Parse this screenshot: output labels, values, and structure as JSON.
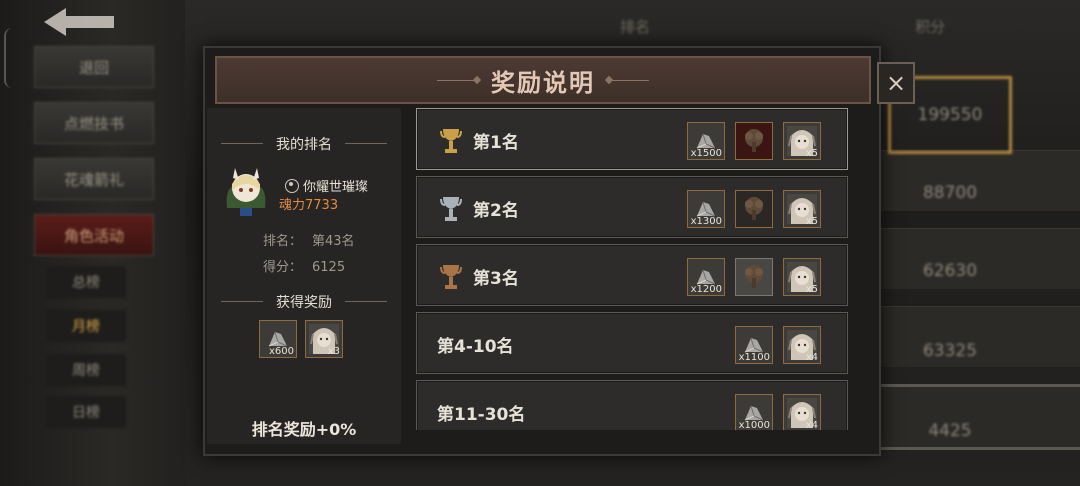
{
  "background": {
    "side_menu": [
      "退回",
      "点燃技书",
      "花魂箭礼",
      "角色活动"
    ],
    "sub_menu": [
      "总榜",
      "月榜",
      "周榜",
      "日榜"
    ],
    "header_cols": [
      "排名",
      "积分"
    ],
    "scores": [
      "199550",
      "88700",
      "62630",
      "63325",
      "4425"
    ]
  },
  "dialog": {
    "title": "奖励说明",
    "close": "×",
    "my_rank_header": "我的排名",
    "player_name": "你耀世璀璨",
    "power": "魂力7733",
    "rank_label": "排名：",
    "rank_value": "第43名",
    "score_label": "得分：",
    "score_value": "6125",
    "rewards_header": "获得奖励",
    "my_rewards": [
      {
        "icon": "ore-icon",
        "count": "x600"
      },
      {
        "icon": "portrait-icon",
        "count": "x3"
      }
    ],
    "bonus": "排名奖励+0%"
  },
  "ranks": [
    {
      "label": "第1名",
      "trophy": "gold-trophy-icon",
      "rewards": [
        {
          "icon": "ore-icon",
          "count": "x1500",
          "style": ""
        },
        {
          "icon": "tree-emblem-icon",
          "count": "",
          "style": "red"
        },
        {
          "icon": "portrait-icon",
          "count": "x5",
          "style": ""
        }
      ]
    },
    {
      "label": "第2名",
      "trophy": "silver-trophy-icon",
      "rewards": [
        {
          "icon": "ore-icon",
          "count": "x1300",
          "style": ""
        },
        {
          "icon": "tree-emblem-icon",
          "count": "",
          "style": "dark"
        },
        {
          "icon": "portrait-icon",
          "count": "x5",
          "style": ""
        }
      ]
    },
    {
      "label": "第3名",
      "trophy": "bronze-trophy-icon",
      "rewards": [
        {
          "icon": "ore-icon",
          "count": "x1200",
          "style": ""
        },
        {
          "icon": "tree-emblem-icon",
          "count": "",
          "style": "grey"
        },
        {
          "icon": "portrait-icon",
          "count": "x5",
          "style": ""
        }
      ]
    },
    {
      "label": "第4-10名",
      "trophy": "",
      "rewards": [
        {
          "icon": "ore-icon",
          "count": "x1100",
          "style": ""
        },
        {
          "icon": "portrait-icon",
          "count": "x4",
          "style": ""
        }
      ]
    },
    {
      "label": "第11-30名",
      "trophy": "",
      "rewards": [
        {
          "icon": "ore-icon",
          "count": "x1000",
          "style": ""
        },
        {
          "icon": "portrait-icon",
          "count": "x4",
          "style": ""
        }
      ]
    }
  ]
}
